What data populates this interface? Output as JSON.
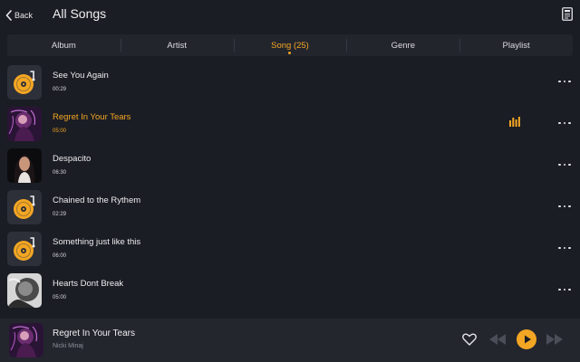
{
  "header": {
    "back_label": "Back",
    "title": "All Songs"
  },
  "tabs": [
    {
      "label": "Album"
    },
    {
      "label": "Artist"
    },
    {
      "label": "Song (25)"
    },
    {
      "label": "Genre"
    },
    {
      "label": "Playlist"
    }
  ],
  "active_tab_index": 2,
  "songs": [
    {
      "title": "See You Again",
      "duration": "00:29",
      "art": "disc"
    },
    {
      "title": "Regret In Your Tears",
      "duration": "05:00",
      "art": "photo-neon",
      "playing": true
    },
    {
      "title": "Despacito",
      "duration": "06:30",
      "art": "photo-portrait"
    },
    {
      "title": "Chained to the Rythem",
      "duration": "02:29",
      "art": "disc"
    },
    {
      "title": "Something just like this",
      "duration": "06:00",
      "art": "disc"
    },
    {
      "title": "Hearts Dont Break",
      "duration": "05:00",
      "art": "photo-bw"
    }
  ],
  "now_playing": {
    "title": "Regret In Your Tears",
    "artist": "Nicki Minaj"
  },
  "colors": {
    "accent": "#f3a623",
    "background": "#1b1d24",
    "tab_bar": "#23252d",
    "player_bar": "#24262e"
  },
  "icons": {
    "back": "chevron-left-icon",
    "document": "document-icon",
    "more": "more-horizontal-icon",
    "equalizer": "equalizer-icon",
    "favorite": "heart-icon",
    "previous": "rewind-icon",
    "play": "play-icon",
    "next": "fast-forward-icon"
  }
}
